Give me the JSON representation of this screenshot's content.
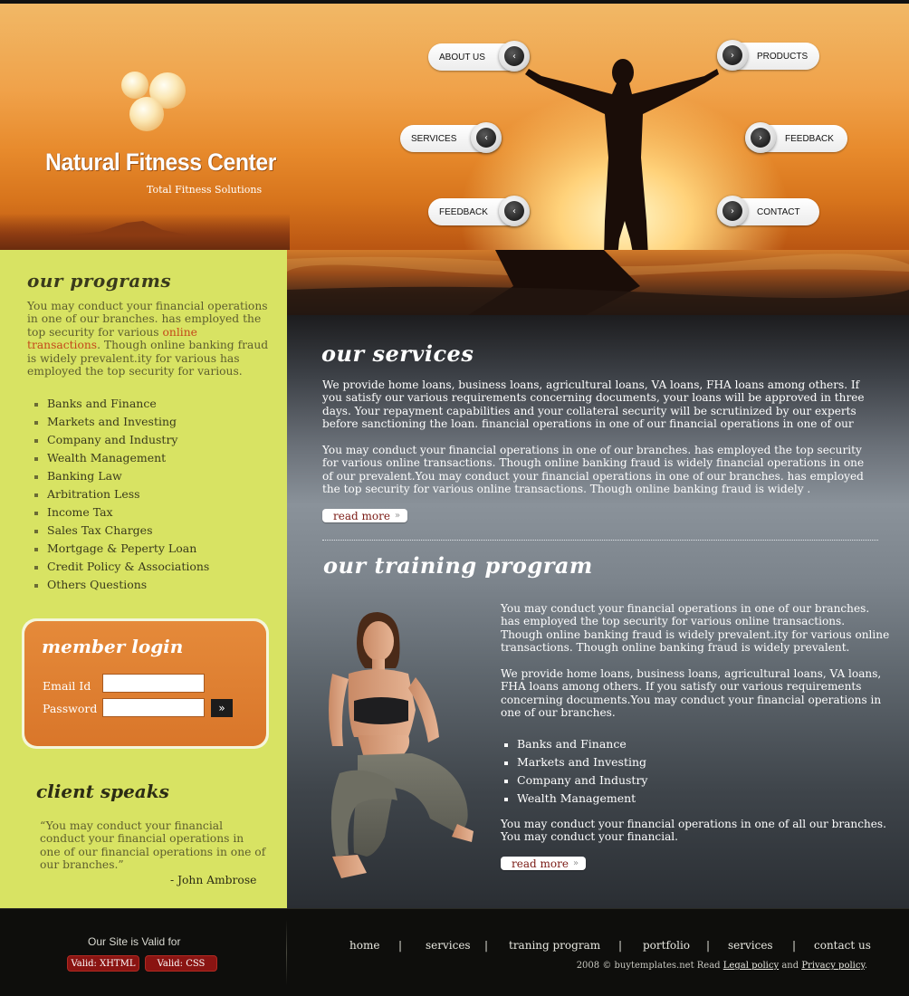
{
  "header": {
    "logo_title": "Natural Fitness Center",
    "logo_tagline": "Total Fitness Solutions",
    "nav": [
      {
        "label": "ABOUT US",
        "icon": "chevron-left-icon"
      },
      {
        "label": "PRODUCTS",
        "icon": "chevron-right-icon"
      },
      {
        "label": "SERVICES",
        "icon": "chevron-left-icon"
      },
      {
        "label": "FEEDBACK",
        "icon": "chevron-right-icon"
      },
      {
        "label": "FEEDBACK",
        "icon": "chevron-left-icon"
      },
      {
        "label": "CONTACT",
        "icon": "chevron-right-icon"
      }
    ],
    "nav_arrow_left": "‹",
    "nav_arrow_right": "›"
  },
  "sidebar": {
    "programs_title": "our programs",
    "programs_text_1": "You may conduct your financial operations in one of our branches. has employed the top security for various ",
    "programs_link": "online transactions",
    "programs_text_2": ". Though online banking fraud is widely prevalent.ity for various has employed the top security for various.",
    "programs": [
      "Banks and Finance",
      "Markets and Investing",
      "Company and Industry",
      "Wealth Management",
      "Banking Law",
      "Arbitration Less",
      "Income Tax",
      "Sales Tax Charges",
      "Mortgage & Peperty Loan",
      "Credit Policy & Associations",
      "Others Questions"
    ],
    "login": {
      "title": "member login",
      "email_label": "Email Id",
      "password_label": "Password",
      "email_value": "",
      "password_value": "",
      "go_label": "»"
    },
    "client_title": "client speaks",
    "client_quote": "“You may conduct your financial conduct your financial operations in one of our financial operations in one of our branches.”",
    "client_author": "- John Ambrose"
  },
  "main": {
    "services_title": "our services",
    "services_p1": "We provide home loans, business loans, agricultural loans, VA loans, FHA loans among others. If you satisfy our various requirements concerning documents, your loans will be approved in three days. Your repayment capabilities and your collateral security will be scrutinized by our experts before sanctioning the loan. financial operations in one of our   financial operations in one of our",
    "services_p2": "You may conduct your financial operations in one of our branches. has employed the top security for various online transactions. Though online banking fraud is widely   financial operations in one of our prevalent.You may conduct your financial operations in one of our branches. has employed the top security for various online transactions. Though online banking fraud is widely .",
    "read_more": "read more",
    "read_more_arrow": "»",
    "training_title": "our training program",
    "training_p1": "You may conduct your financial operations in one of our branches. has employed the top security for various online transactions. Though online banking fraud is widely prevalent.ity for various online transactions. Though online banking fraud is widely prevalent.",
    "training_p2": "We provide home loans, business loans, agricultural loans, VA loans, FHA loans among others. If you satisfy our various requirements concerning documents.You may conduct your financial operations in one of our branches.",
    "training_list": [
      "Banks and Finance",
      "Markets and Investing",
      "Company and Industry",
      "Wealth Management"
    ],
    "training_p3": "You may conduct your financial operations in one of all our branches. You may conduct your financial."
  },
  "footer": {
    "valid_text": "Our Site is Valid for",
    "badge_xhtml": "Valid: XHTML",
    "badge_css": "Valid: CSS",
    "nav": [
      "home",
      "services",
      "traning program",
      "portfolio",
      "services",
      "contact us"
    ],
    "separator": "|",
    "copy_prefix": "2008 © buytemplates.net Read ",
    "legal": "Legal policy",
    "and": " and ",
    "privacy": "Privacy policy",
    "copy_suffix": "."
  },
  "colors": {
    "sidebar_bg": "#d8e363",
    "login_bg": "#e58a3a",
    "link_accent": "#c4481a",
    "badge": "#8a1412"
  }
}
